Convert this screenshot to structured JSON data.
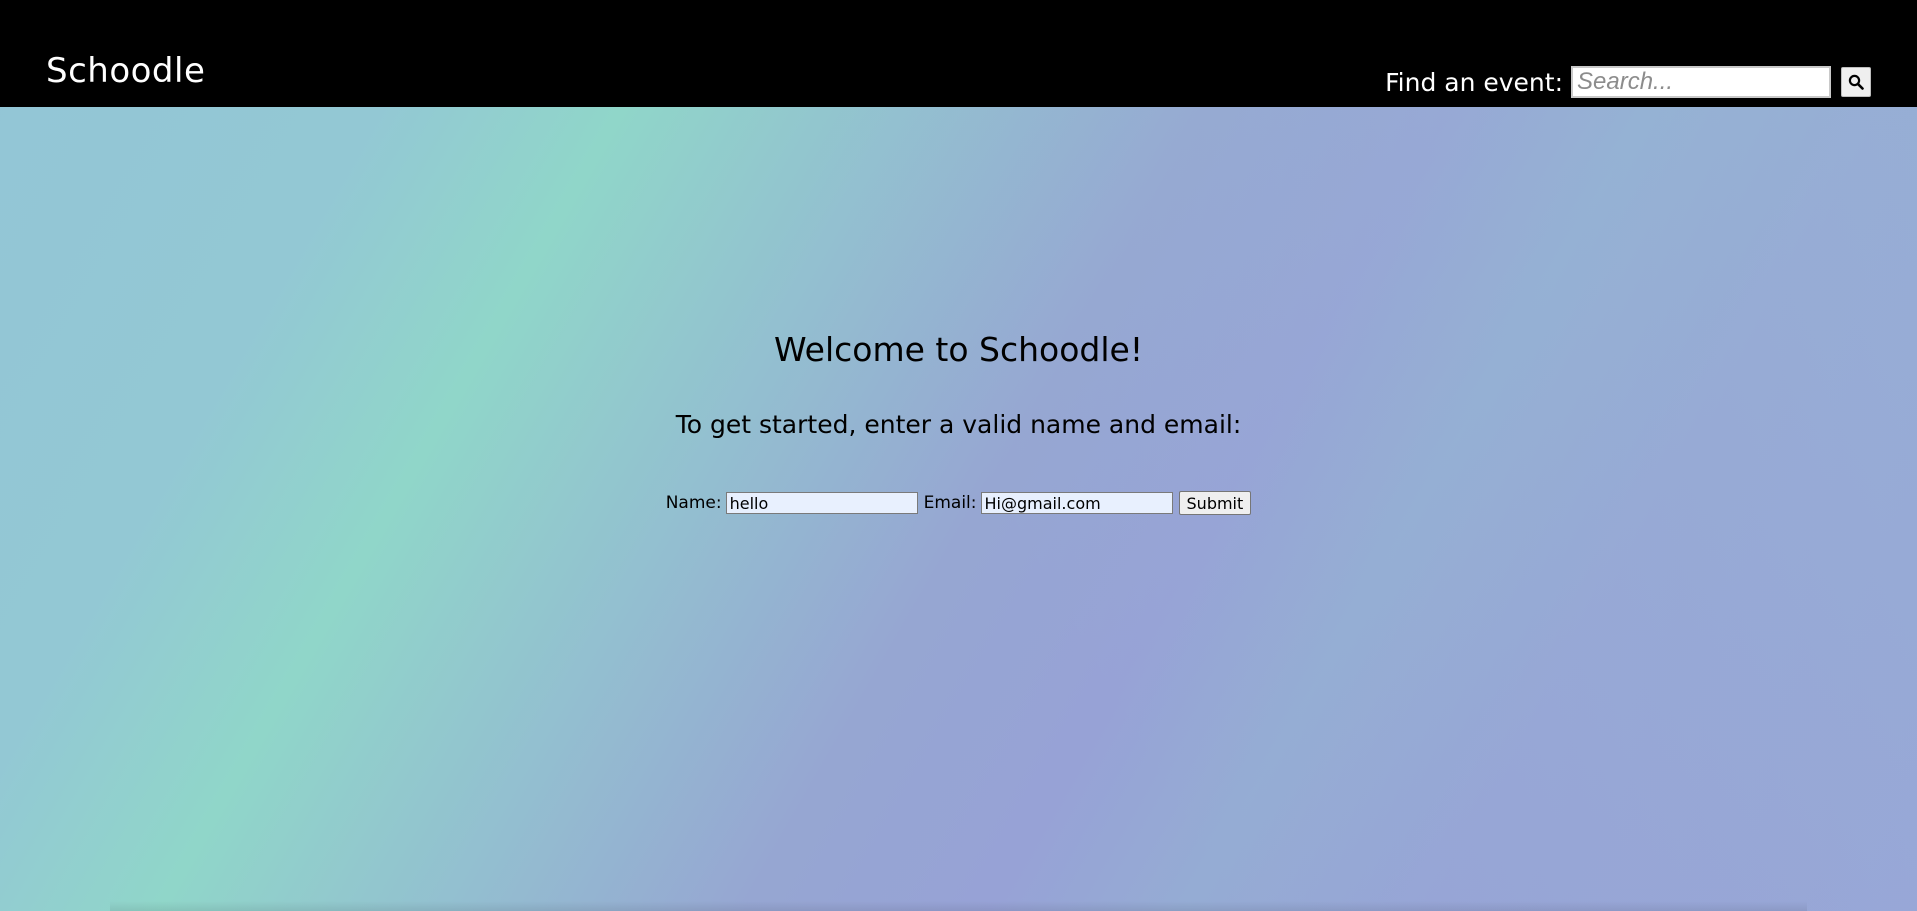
{
  "header": {
    "logo_text": "Schoodle",
    "search_label": "Find an event:",
    "search_placeholder": "Search...",
    "search_value": "",
    "search_button_icon": "search-icon"
  },
  "main": {
    "welcome_title": "Welcome to Schoodle!",
    "subtitle": "To get started, enter a valid name and email:",
    "form": {
      "name_label": "Name:",
      "name_value": "hello",
      "email_label": "Email:",
      "email_value": "Hi@gmail.com",
      "submit_label": "Submit"
    }
  },
  "colors": {
    "header_background": "#000000",
    "header_text": "#ffffff",
    "autofill_background": "#e8f0fe",
    "gradient_teal": "#90d6c9",
    "gradient_blue": "#93c5d6",
    "gradient_lavender": "#97a2d6"
  }
}
